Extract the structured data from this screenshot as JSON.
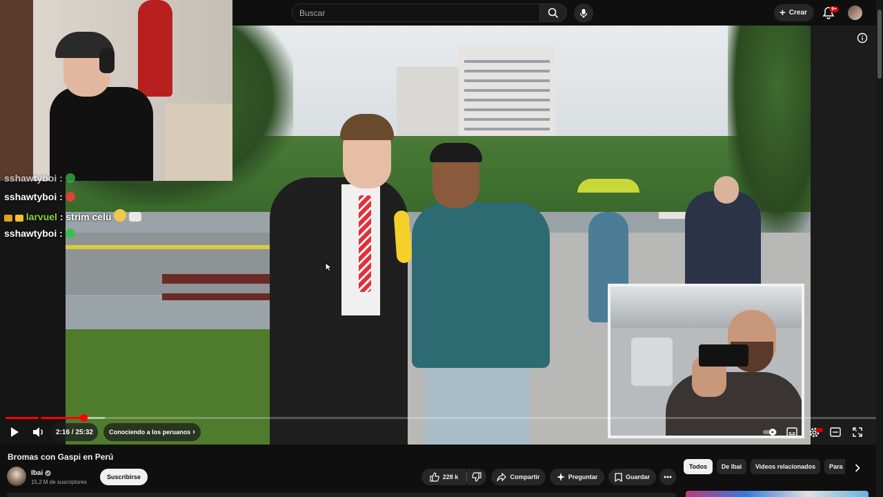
{
  "header": {
    "search_placeholder": "Buscar",
    "create_label": "Crear",
    "notifications_badge": "9+"
  },
  "chat": {
    "lines": [
      {
        "user": "sshawtyboi :",
        "message": ""
      },
      {
        "user": "sshawtyboi :",
        "message": ""
      },
      {
        "user": "larvuel",
        "message": ": strim celu"
      },
      {
        "user": "sshawtyboi :",
        "message": ""
      }
    ]
  },
  "player": {
    "time": "2:16 / 25:32",
    "chapter": "Conociendo a los peruanos",
    "progress_played_fraction": 0.09,
    "progress_loaded_fraction": 0.114
  },
  "video": {
    "title": "Bromas con Gaspi en Perú",
    "channel": "Ibai",
    "subscribers": "15,2 M de suscriptores",
    "subscribe_label": "Suscribirse"
  },
  "actions": {
    "likes": "228 k",
    "share": "Compartir",
    "ask": "Preguntar",
    "save": "Guardar"
  },
  "chips": [
    "Todos",
    "De Ibai",
    "Videos relacionados",
    "Para"
  ],
  "colors": {
    "background": "#0f0f0f",
    "accent_red": "#ff0000",
    "chat_user_green": "#8bd63a"
  }
}
